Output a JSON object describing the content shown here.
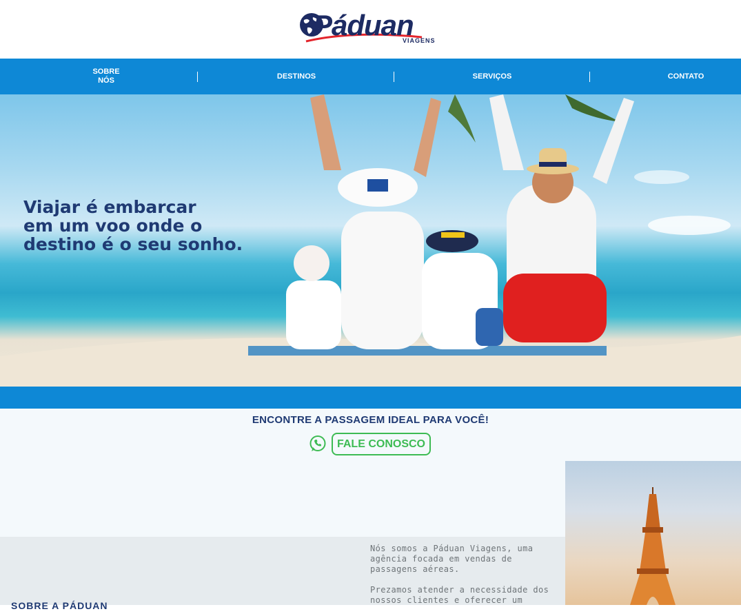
{
  "brand": {
    "name": "Páduan",
    "subtitle": "VIAGENS",
    "colors": {
      "navy": "#1d2b63",
      "accent_red": "#e3242b",
      "nav_blue": "#0e88d6",
      "whatsapp_green": "#3dbb53"
    }
  },
  "nav": {
    "items": [
      {
        "label_line1": "SOBRE",
        "label_line2": "NÓS"
      },
      {
        "label": "DESTINOS"
      },
      {
        "label": "SERVIÇOS"
      },
      {
        "label": "CONTATO"
      }
    ],
    "separator": "|"
  },
  "hero": {
    "headline_lines": [
      "Viajar é embarcar",
      "em um voo onde o",
      "destino é o seu sonho."
    ]
  },
  "cta": {
    "title": "ENCONTRE A PASSAGEM IDEAL PARA VOCÊ!",
    "button_label": "FALE CONOSCO",
    "icon": "whatsapp-icon"
  },
  "about": {
    "heading": "SOBRE A PÁDUAN",
    "paragraphs": [
      "Nós somos a Páduan Viagens, uma agência focada em vendas de passagens aéreas.",
      "Prezamos atender a necessidade dos nossos clientes e oferecer um"
    ]
  }
}
